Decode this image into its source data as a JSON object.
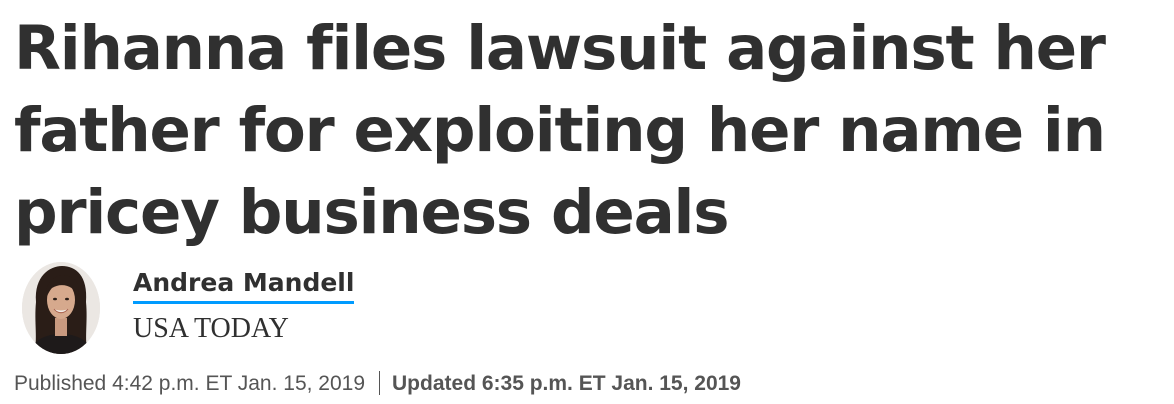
{
  "headline": {
    "line1": "Rihanna files lawsuit against her",
    "line2": "father for exploiting her name in",
    "line3": "pricey business deals"
  },
  "byline": {
    "author": "Andrea Mandell",
    "outlet": "USA TODAY",
    "accent_color": "#009bff"
  },
  "dates": {
    "published": "Published 4:42 p.m. ET Jan. 15, 2019",
    "updated": "Updated 6:35 p.m. ET Jan. 15, 2019"
  }
}
